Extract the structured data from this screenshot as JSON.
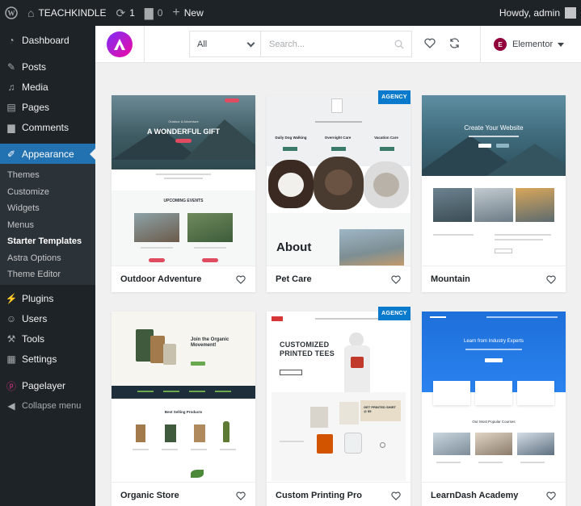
{
  "admin_bar": {
    "site_name": "TEACHKINDLE",
    "updates_count": "1",
    "comments_count": "0",
    "new_label": "New",
    "howdy": "Howdy, admin"
  },
  "sidebar": {
    "items": [
      {
        "label": "Dashboard",
        "icon": "dashboard-icon"
      },
      {
        "label": "Posts",
        "icon": "pin-icon"
      },
      {
        "label": "Media",
        "icon": "media-icon"
      },
      {
        "label": "Pages",
        "icon": "pages-icon"
      },
      {
        "label": "Comments",
        "icon": "comments-icon"
      },
      {
        "label": "Appearance",
        "icon": "brush-icon"
      },
      {
        "label": "Plugins",
        "icon": "plug-icon"
      },
      {
        "label": "Users",
        "icon": "users-icon"
      },
      {
        "label": "Tools",
        "icon": "wrench-icon"
      },
      {
        "label": "Settings",
        "icon": "settings-icon"
      },
      {
        "label": "Pagelayer",
        "icon": "pagelayer-icon"
      },
      {
        "label": "Collapse menu",
        "icon": "collapse-icon"
      }
    ],
    "appearance_submenu": [
      "Themes",
      "Customize",
      "Widgets",
      "Menus",
      "Starter Templates",
      "Astra Options",
      "Theme Editor"
    ]
  },
  "toolbar": {
    "category_value": "All",
    "search_placeholder": "Search...",
    "builder_label": "Elementor",
    "builder_badge": "E"
  },
  "badge_label": "AGENCY",
  "templates": [
    {
      "title": "Outdoor Adventure",
      "agency": false,
      "thumb": {
        "hero_heading": "A WONDERFUL GIFT",
        "hero_kicker": "Outdoor & Adventure",
        "section_heading": "UPCOMING EVENTS"
      }
    },
    {
      "title": "Pet Care",
      "agency": true,
      "thumb": {
        "services": [
          "Daily Dog Walking",
          "Overnight Care",
          "Vacation Care"
        ],
        "about_heading": "About"
      }
    },
    {
      "title": "Mountain",
      "agency": false,
      "thumb": {
        "hero_heading": "Create Your Website"
      }
    },
    {
      "title": "Organic Store",
      "agency": false,
      "thumb": {
        "hero_heading": "Join the Organic Movement!",
        "section_heading": "Best Selling Products"
      }
    },
    {
      "title": "Custom Printing Pro",
      "agency": true,
      "thumb": {
        "hero_heading_1": "CUSTOMIZED",
        "hero_heading_2": "PRINTED TEES",
        "promo": "GET PRINTED SHIRT @ $5"
      }
    },
    {
      "title": "LearnDash Academy",
      "agency": false,
      "thumb": {
        "hero_heading": "Learn from Industry Experts",
        "section_heading": "Our Most Popular Courses"
      }
    }
  ],
  "colors": {
    "wp_dark": "#1d2327",
    "wp_blue": "#2271b1",
    "agency_blue": "#0a7acc",
    "astra_purple": "#7b2ff7",
    "elementor": "#92003b"
  }
}
